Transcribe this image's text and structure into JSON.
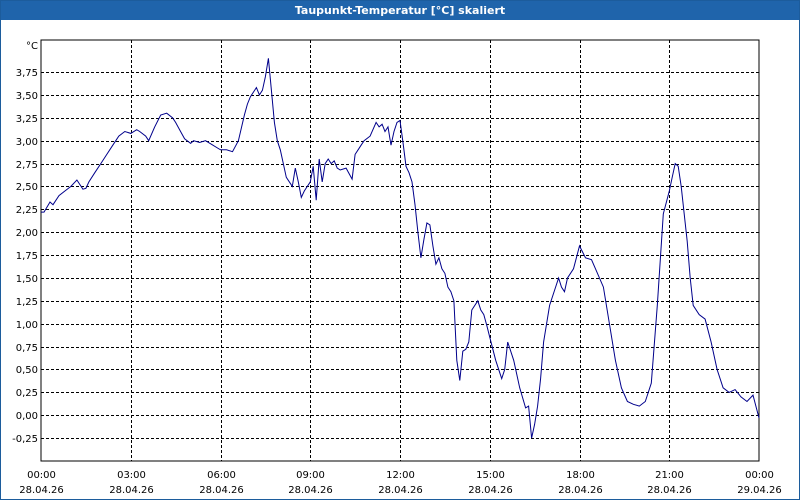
{
  "window": {
    "title": "Taupunkt-Temperatur [°C] skaliert"
  },
  "colors": {
    "titlebar": "#1f64ab",
    "line": "#00008b",
    "grid": "#000000"
  },
  "chart_data": {
    "type": "line",
    "title": "Taupunkt-Temperatur [°C] skaliert",
    "ylabel": "°C",
    "xlabel": "",
    "grid": true,
    "ylim": [
      -0.5,
      4.1
    ],
    "xlim": [
      0,
      24
    ],
    "yticks": [
      -0.25,
      0,
      0.25,
      0.5,
      0.75,
      1,
      1.25,
      1.5,
      1.75,
      2,
      2.25,
      2.5,
      2.75,
      3,
      3.25,
      3.5,
      3.75
    ],
    "ytick_labels": [
      "-0,25",
      "0,00",
      "0,25",
      "0,50",
      "0,75",
      "1,00",
      "1,25",
      "1,50",
      "1,75",
      "2,00",
      "2,25",
      "2,50",
      "2,75",
      "3,00",
      "3,25",
      "3,50",
      "3,75"
    ],
    "xticks": [
      0,
      3,
      6,
      9,
      12,
      15,
      18,
      21,
      24
    ],
    "xtick_labels": [
      {
        "time": "00:00",
        "date": "28.04.26"
      },
      {
        "time": "03:00",
        "date": "28.04.26"
      },
      {
        "time": "06:00",
        "date": "28.04.26"
      },
      {
        "time": "09:00",
        "date": "28.04.26"
      },
      {
        "time": "12:00",
        "date": "28.04.26"
      },
      {
        "time": "15:00",
        "date": "28.04.26"
      },
      {
        "time": "18:00",
        "date": "28.04.26"
      },
      {
        "time": "21:00",
        "date": "28.04.26"
      },
      {
        "time": "00:00",
        "date": "29.04.26"
      }
    ],
    "series": [
      {
        "x": [
          0,
          0.1,
          0.3,
          0.4,
          0.6,
          0.8,
          1.0,
          1.2,
          1.4,
          1.5,
          1.6,
          1.8,
          2.0,
          2.2,
          2.4,
          2.6,
          2.8,
          3.0,
          3.2,
          3.3,
          3.5,
          3.6,
          3.8,
          4.0,
          4.2,
          4.4,
          4.5,
          4.7,
          4.8,
          5.0,
          5.1,
          5.3,
          5.5,
          5.7,
          5.9,
          6.0,
          6.2,
          6.4,
          6.6,
          6.8,
          6.9,
          7.0,
          7.2,
          7.3,
          7.4,
          7.5,
          7.6,
          7.7,
          7.8,
          7.9,
          8.0,
          8.2,
          8.4,
          8.5,
          8.6,
          8.7,
          8.8,
          8.9,
          9.0,
          9.1,
          9.2,
          9.3,
          9.4,
          9.5,
          9.6,
          9.7,
          9.8,
          9.9,
          10.0,
          10.2,
          10.4,
          10.5,
          10.6,
          10.7,
          10.8,
          11.0,
          11.2,
          11.3,
          11.4,
          11.5,
          11.6,
          11.7,
          11.8,
          11.9,
          12.0,
          12.1,
          12.2,
          12.3,
          12.4,
          12.5,
          12.6,
          12.7,
          12.8,
          12.9,
          13.0,
          13.1,
          13.2,
          13.3,
          13.4,
          13.5,
          13.6,
          13.7,
          13.8,
          13.9,
          14.0,
          14.1,
          14.2,
          14.3,
          14.4,
          14.6,
          14.7,
          14.8,
          14.9,
          15.0,
          15.2,
          15.4,
          15.5,
          15.6,
          15.8,
          16.0,
          16.2,
          16.3,
          16.4,
          16.5,
          16.6,
          16.7,
          16.8,
          16.9,
          17.0,
          17.2,
          17.3,
          17.4,
          17.5,
          17.6,
          17.8,
          18.0,
          18.2,
          18.4,
          18.6,
          18.8,
          19.0,
          19.2,
          19.4,
          19.6,
          19.8,
          20.0,
          20.2,
          20.4,
          20.6,
          20.8,
          21.0,
          21.1,
          21.2,
          21.3,
          21.4,
          21.5,
          21.6,
          21.7,
          21.8,
          22.0,
          22.2,
          22.4,
          22.6,
          22.8,
          23.0,
          23.2,
          23.4,
          23.6,
          23.8,
          24.0
        ],
        "y": [
          2.22,
          2.22,
          2.33,
          2.3,
          2.4,
          2.45,
          2.5,
          2.57,
          2.47,
          2.48,
          2.55,
          2.65,
          2.75,
          2.85,
          2.95,
          3.05,
          3.1,
          3.08,
          3.12,
          3.1,
          3.05,
          3.0,
          3.15,
          3.28,
          3.3,
          3.25,
          3.2,
          3.08,
          3.02,
          2.97,
          3.0,
          2.98,
          3.0,
          2.96,
          2.92,
          2.9,
          2.9,
          2.88,
          3.0,
          3.28,
          3.4,
          3.48,
          3.58,
          3.5,
          3.55,
          3.7,
          3.9,
          3.55,
          3.2,
          3.0,
          2.9,
          2.6,
          2.5,
          2.7,
          2.55,
          2.38,
          2.45,
          2.5,
          2.55,
          2.72,
          2.35,
          2.8,
          2.55,
          2.75,
          2.8,
          2.75,
          2.78,
          2.7,
          2.68,
          2.7,
          2.58,
          2.85,
          2.9,
          2.95,
          3.0,
          3.05,
          3.2,
          3.15,
          3.18,
          3.1,
          3.15,
          2.95,
          3.1,
          3.2,
          3.22,
          2.98,
          2.72,
          2.65,
          2.55,
          2.3,
          2.0,
          1.72,
          1.92,
          2.1,
          2.08,
          1.85,
          1.65,
          1.72,
          1.6,
          1.55,
          1.4,
          1.35,
          1.25,
          0.6,
          0.38,
          0.7,
          0.72,
          0.8,
          1.15,
          1.25,
          1.15,
          1.1,
          0.98,
          0.85,
          0.6,
          0.4,
          0.5,
          0.8,
          0.6,
          0.3,
          0.08,
          0.1,
          -0.25,
          -0.1,
          0.1,
          0.4,
          0.8,
          1.0,
          1.2,
          1.4,
          1.5,
          1.4,
          1.35,
          1.5,
          1.6,
          1.85,
          1.72,
          1.7,
          1.55,
          1.4,
          1.0,
          0.6,
          0.3,
          0.15,
          0.12,
          0.1,
          0.15,
          0.35,
          1.2,
          2.2,
          2.45,
          2.6,
          2.75,
          2.72,
          2.5,
          2.2,
          1.9,
          1.5,
          1.2,
          1.1,
          1.05,
          0.8,
          0.5,
          0.3,
          0.25,
          0.28,
          0.2,
          0.15,
          0.22,
          -0.03
        ]
      }
    ]
  }
}
